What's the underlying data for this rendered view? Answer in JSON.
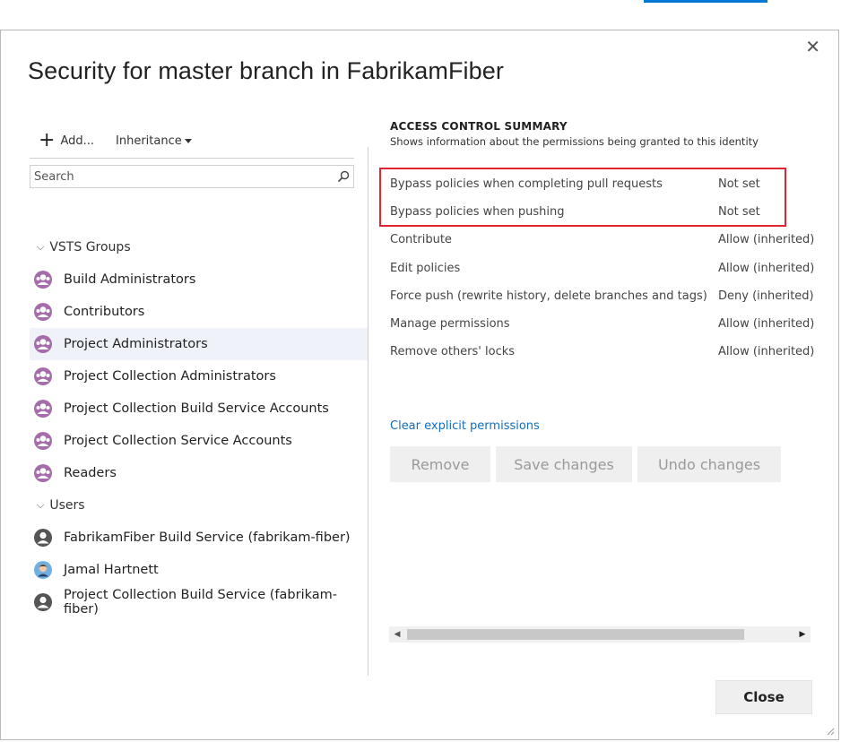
{
  "dialog": {
    "title": "Security for master branch in FabrikamFiber",
    "close_glyph": "✕",
    "close_button_label": "Close"
  },
  "toolbar": {
    "add_label": "Add...",
    "inheritance_label": "Inheritance"
  },
  "search": {
    "placeholder": "Search"
  },
  "groups": [
    {
      "label": "VSTS Groups",
      "items": [
        {
          "label": "Build Administrators",
          "type": "group",
          "selected": false
        },
        {
          "label": "Contributors",
          "type": "group",
          "selected": false
        },
        {
          "label": "Project Administrators",
          "type": "group",
          "selected": true
        },
        {
          "label": "Project Collection Administrators",
          "type": "group",
          "selected": false
        },
        {
          "label": "Project Collection Build Service Accounts",
          "type": "group",
          "selected": false
        },
        {
          "label": "Project Collection Service Accounts",
          "type": "group",
          "selected": false
        },
        {
          "label": "Readers",
          "type": "group",
          "selected": false
        }
      ]
    },
    {
      "label": "Users",
      "items": [
        {
          "label": "FabrikamFiber Build Service (fabrikam-fiber)",
          "type": "service",
          "selected": false
        },
        {
          "label": "Jamal Hartnett",
          "type": "person",
          "selected": false
        },
        {
          "label": "Project Collection Build Service (fabrikam-fiber)",
          "type": "service",
          "selected": false
        }
      ]
    }
  ],
  "summary": {
    "title": "ACCESS CONTROL SUMMARY",
    "subtitle": "Shows information about the permissions being granted to this identity",
    "permissions": [
      {
        "name": "Bypass policies when completing pull requests",
        "value": "Not set"
      },
      {
        "name": "Bypass policies when pushing",
        "value": "Not set"
      },
      {
        "name": "Contribute",
        "value": "Allow (inherited)"
      },
      {
        "name": "Edit policies",
        "value": "Allow (inherited)"
      },
      {
        "name": "Force push (rewrite history, delete branches and tags)",
        "value": "Deny (inherited)"
      },
      {
        "name": "Manage permissions",
        "value": "Allow (inherited)"
      },
      {
        "name": "Remove others' locks",
        "value": "Allow (inherited)"
      }
    ],
    "clear_link": "Clear explicit permissions",
    "buttons": {
      "remove": "Remove",
      "save": "Save changes",
      "undo": "Undo changes"
    }
  },
  "colors": {
    "accent": "#0078d4",
    "highlight": "#e0242f",
    "group_avatar": "#a56eaa",
    "service_avatar": "#555555",
    "link": "#106ebe"
  }
}
